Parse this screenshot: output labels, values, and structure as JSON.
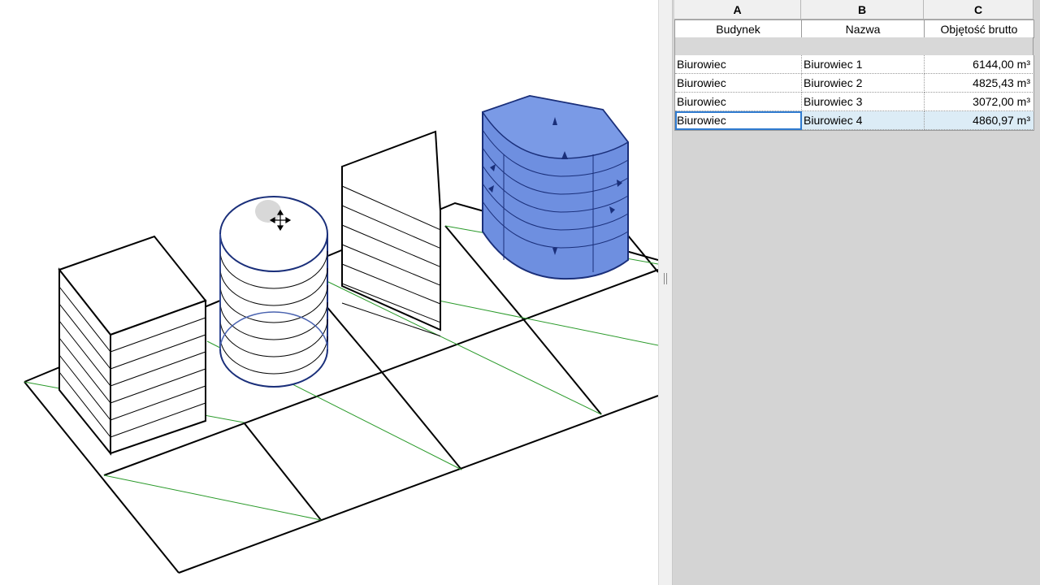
{
  "schedule": {
    "columns": [
      "A",
      "B",
      "C"
    ],
    "headers": [
      "Budynek",
      "Nazwa",
      "Objętość brutto"
    ],
    "rows": [
      {
        "budynek": "Biurowiec",
        "nazwa": "Biurowiec 1",
        "objetosc": "6144,00 m³"
      },
      {
        "budynek": "Biurowiec",
        "nazwa": "Biurowiec 2",
        "objetosc": "4825,43 m³"
      },
      {
        "budynek": "Biurowiec",
        "nazwa": "Biurowiec 3",
        "objetosc": "3072,00 m³"
      },
      {
        "budynek": "Biurowiec",
        "nazwa": "Biurowiec 4",
        "objetosc": "4860,97 m³"
      }
    ],
    "selected_row": 3
  },
  "viewport": {
    "selected_mass_color": "#6e8fe0",
    "selection_outline_color": "#1a2f7a",
    "property_line_color": "#2a9a2a",
    "cursor_icon": "move-cursor-icon"
  }
}
